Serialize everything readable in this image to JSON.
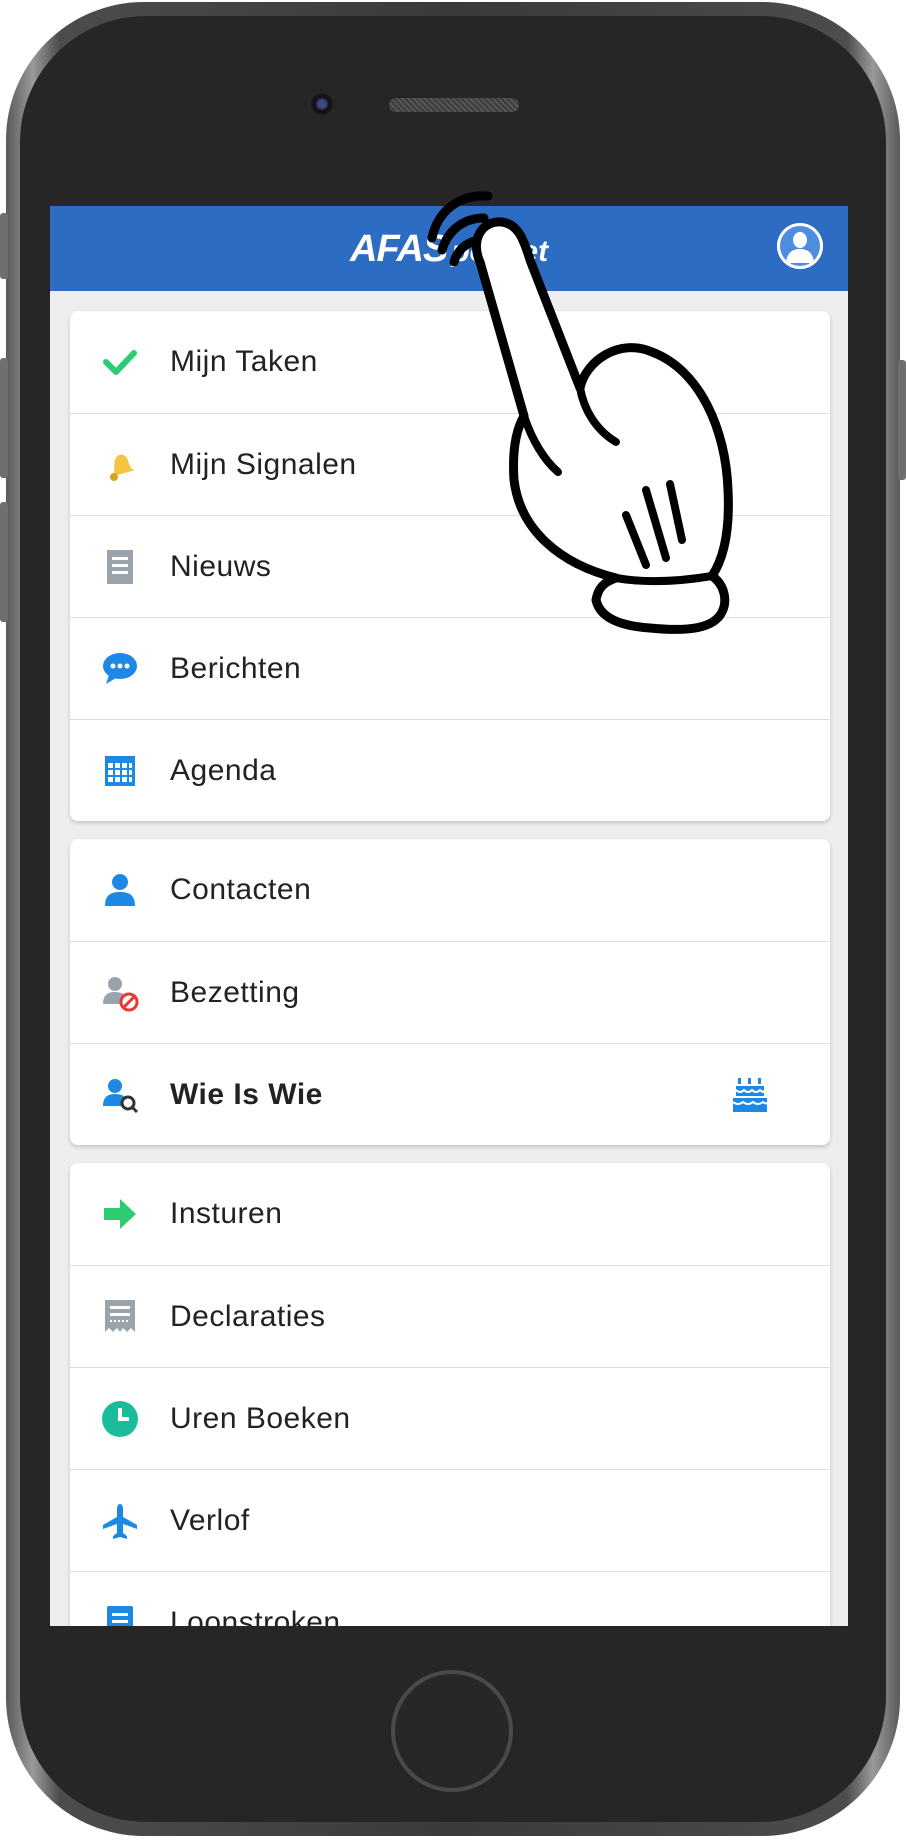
{
  "app": {
    "logo_main": "AFAS",
    "logo_sub": "pocket"
  },
  "menu_groups": [
    {
      "items": [
        {
          "label": "Mijn Taken",
          "icon": "checkmark-icon",
          "color": "#2ecc71"
        },
        {
          "label": "Mijn Signalen",
          "icon": "bell-icon",
          "color": "#f5c542"
        },
        {
          "label": "Nieuws",
          "icon": "document-icon",
          "color": "#9aa4ad"
        },
        {
          "label": "Berichten",
          "icon": "chat-bubble-icon",
          "color": "#1e88e5"
        },
        {
          "label": "Agenda",
          "icon": "calendar-grid-icon",
          "color": "#1e88e5"
        }
      ]
    },
    {
      "items": [
        {
          "label": "Contacten",
          "icon": "person-icon",
          "color": "#1e88e5"
        },
        {
          "label": "Bezetting",
          "icon": "person-unavailable-icon",
          "color": "#9aa4ad"
        },
        {
          "label": "Wie Is Wie",
          "icon": "person-search-icon",
          "color": "#1e88e5",
          "badge_icon": "birthday-cake-icon"
        }
      ]
    },
    {
      "items": [
        {
          "label": "Insturen",
          "icon": "arrow-right-icon",
          "color": "#2ecc71"
        },
        {
          "label": "Declaraties",
          "icon": "receipt-icon",
          "color": "#9aa4ad"
        },
        {
          "label": "Uren Boeken",
          "icon": "clock-icon",
          "color": "#1abc9c"
        },
        {
          "label": "Verlof",
          "icon": "airplane-icon",
          "color": "#1e88e5"
        },
        {
          "label": "Loonstroken",
          "icon": "payslip-icon",
          "color": "#1e88e5"
        }
      ]
    }
  ],
  "colors": {
    "appbar": "#2c6cc2",
    "background": "#eeeeee"
  }
}
